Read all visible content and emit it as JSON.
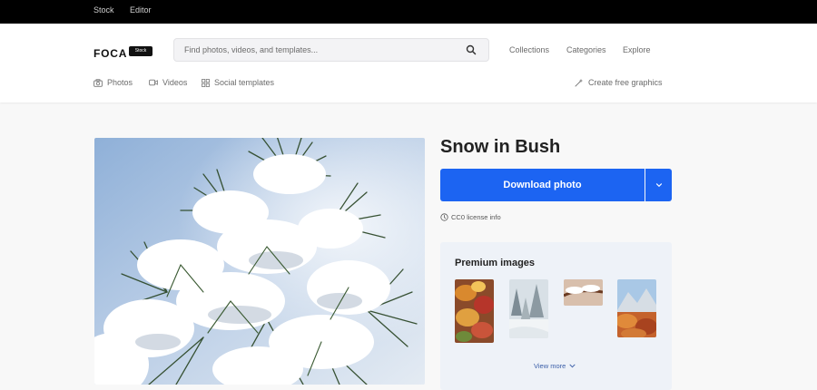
{
  "topbar": {
    "links": [
      "Stock",
      "Editor"
    ]
  },
  "header": {
    "logo": "FOCA",
    "logo_badge": "Stock",
    "search_placeholder": "Find photos, videos, and templates...",
    "nav": [
      "Collections",
      "Categories",
      "Explore"
    ]
  },
  "subnav": {
    "photos": "Photos",
    "videos": "Videos",
    "social": "Social templates",
    "create": "Create free graphics"
  },
  "photo": {
    "title": "Snow in Bush",
    "download_label": "Download photo",
    "license": "CC0 license info"
  },
  "premium": {
    "title": "Premium images",
    "view_more": "View more",
    "thumbnails": [
      "autumn-leaves",
      "snowy-forest",
      "snowy-branch",
      "autumn-mountain"
    ]
  },
  "colors": {
    "accent": "#1c64f2",
    "topbar": "#000000",
    "panel": "#eef2f8"
  }
}
